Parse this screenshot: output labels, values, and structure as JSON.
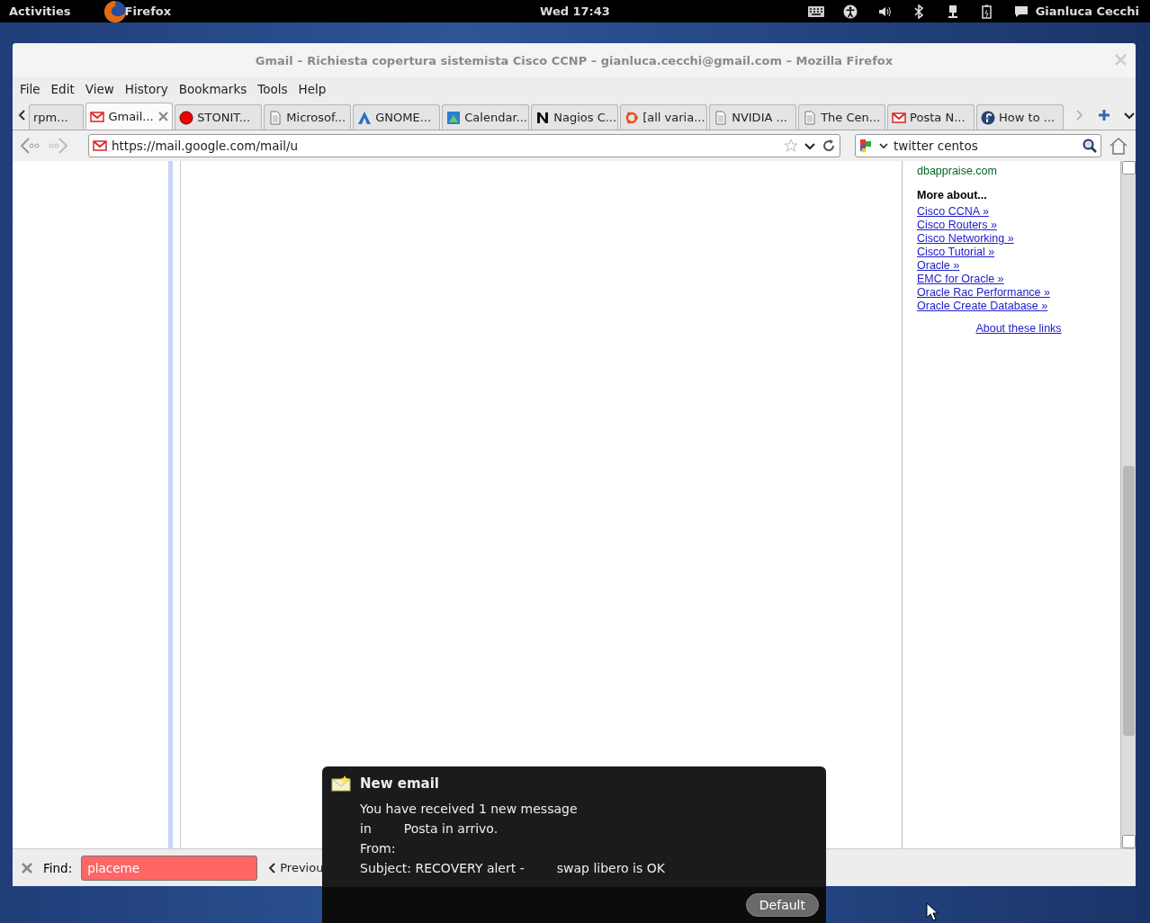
{
  "top_bar": {
    "activities": "Activities",
    "app_name": "Firefox",
    "clock": "Wed 17:43",
    "user": "Gianluca Cecchi"
  },
  "window": {
    "title": "Gmail – Richiesta copertura sistemista Cisco CCNP – gianluca.cecchi@gmail.com – Mozilla Firefox"
  },
  "menu": [
    "File",
    "Edit",
    "View",
    "History",
    "Bookmarks",
    "Tools",
    "Help"
  ],
  "tabs": [
    {
      "label": "rpm...",
      "kind": "none",
      "selected": false
    },
    {
      "label": "Gmail...",
      "kind": "mail",
      "selected": true
    },
    {
      "label": "STONIT...",
      "kind": "stop",
      "selected": false
    },
    {
      "label": "Microsof...",
      "kind": "doc",
      "selected": false
    },
    {
      "label": "GNOME...",
      "kind": "gnome",
      "selected": false
    },
    {
      "label": "Calendar...",
      "kind": "calendar",
      "selected": false
    },
    {
      "label": "Nagios C...",
      "kind": "nagios",
      "selected": false
    },
    {
      "label": "[all varia...",
      "kind": "ubuntu",
      "selected": false
    },
    {
      "label": "NVIDIA ...",
      "kind": "doc",
      "selected": false
    },
    {
      "label": "The Cen...",
      "kind": "doc",
      "selected": false
    },
    {
      "label": "Posta N...",
      "kind": "mail",
      "selected": false
    },
    {
      "label": "How to ...",
      "kind": "fedora",
      "selected": false
    }
  ],
  "nav": {
    "url": "https://mail.google.com/mail/u",
    "search": "twitter centos"
  },
  "sidebar": {
    "source": "dbappraise.com",
    "heading": "More about...",
    "links": [
      "Cisco CCNA »",
      "Cisco Routers »",
      "Cisco Networking »",
      "Cisco Tutorial »",
      "Oracle »",
      "EMC for Oracle »",
      "Oracle Rac Performance »",
      "Oracle Create Database »"
    ],
    "about": "About these links"
  },
  "find_bar": {
    "label": "Find:",
    "value": "placeme",
    "not_found": true,
    "previous": "Previou"
  },
  "notification": {
    "title": "New email",
    "lines": [
      [
        "You have received 1 new message"
      ],
      [
        "in",
        "Posta in arrivo."
      ],
      [
        "From:"
      ],
      [
        "Subject: RECOVERY alert -",
        "swap libero is OK"
      ]
    ],
    "button": "Default"
  }
}
